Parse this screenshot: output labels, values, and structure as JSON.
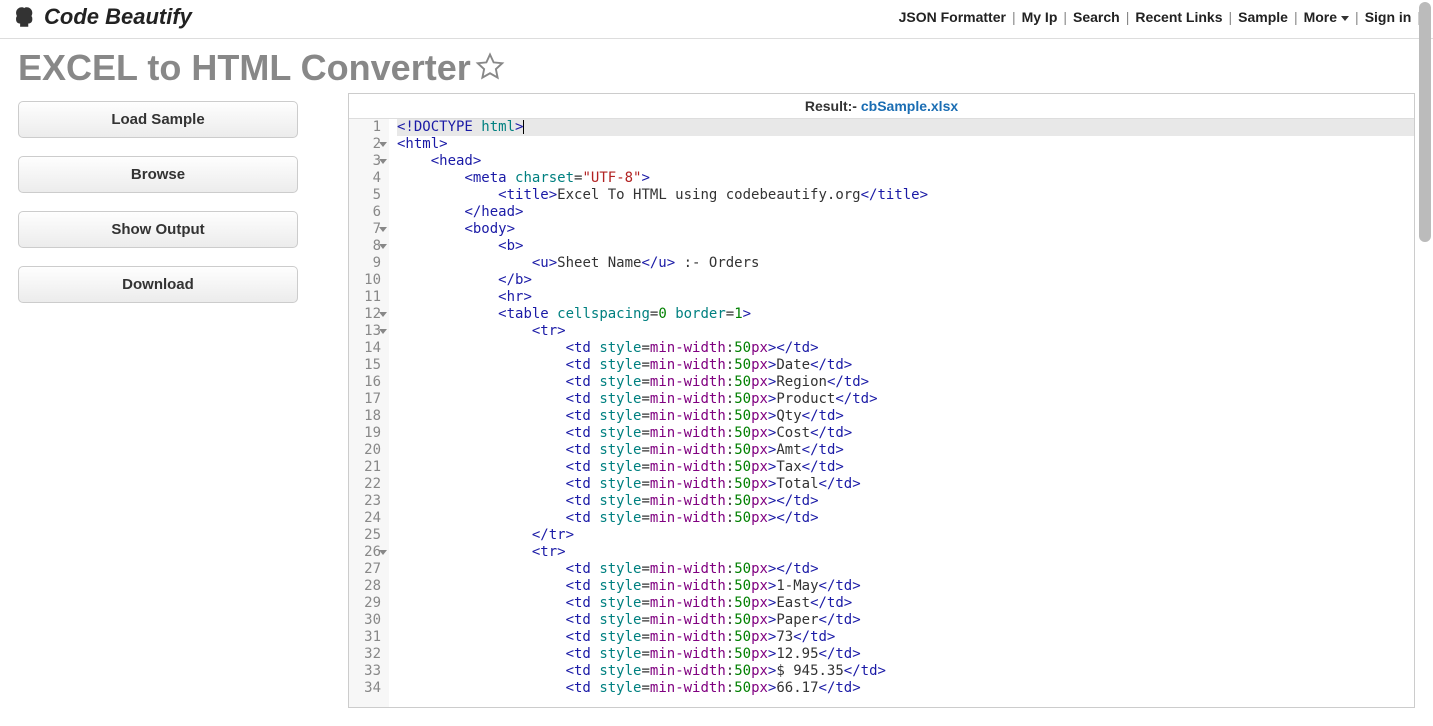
{
  "logo_text": "Code Beautify",
  "nav": {
    "json_formatter": "JSON Formatter",
    "my_ip": "My Ip",
    "search": "Search",
    "recent_links": "Recent Links",
    "sample": "Sample",
    "more": "More",
    "sign_in": "Sign in"
  },
  "page_title": "EXCEL to HTML Converter",
  "sidebar": {
    "load_sample": "Load Sample",
    "browse": "Browse",
    "show_output": "Show Output",
    "download": "Download"
  },
  "result": {
    "label": "Result:-",
    "file": "cbSample.xlsx"
  },
  "code": {
    "lines": [
      {
        "n": 1,
        "fold": false,
        "hl": true,
        "tokens": [
          [
            "tag",
            "<!DOCTYPE"
          ],
          [
            "txt",
            " "
          ],
          [
            "attr",
            "html"
          ],
          [
            "tag",
            ">"
          ]
        ],
        "cursor": true
      },
      {
        "n": 2,
        "fold": true,
        "hl": false,
        "indent": 0,
        "tokens": [
          [
            "tag",
            "<html>"
          ]
        ]
      },
      {
        "n": 3,
        "fold": true,
        "hl": false,
        "indent": 2,
        "tokens": [
          [
            "tag",
            "<head>"
          ]
        ]
      },
      {
        "n": 4,
        "fold": false,
        "hl": false,
        "indent": 4,
        "tokens": [
          [
            "tag",
            "<meta"
          ],
          [
            "txt",
            " "
          ],
          [
            "attr",
            "charset"
          ],
          [
            "txt",
            "="
          ],
          [
            "val",
            "\"UTF-8\""
          ],
          [
            "tag",
            ">"
          ]
        ]
      },
      {
        "n": 5,
        "fold": false,
        "hl": false,
        "indent": 6,
        "tokens": [
          [
            "tag",
            "<title>"
          ],
          [
            "txt",
            "Excel To HTML using codebeautify.org"
          ],
          [
            "tag",
            "</title>"
          ]
        ]
      },
      {
        "n": 6,
        "fold": false,
        "hl": false,
        "indent": 4,
        "tokens": [
          [
            "tag",
            "</head>"
          ]
        ]
      },
      {
        "n": 7,
        "fold": true,
        "hl": false,
        "indent": 4,
        "tokens": [
          [
            "tag",
            "<body>"
          ]
        ]
      },
      {
        "n": 8,
        "fold": true,
        "hl": false,
        "indent": 6,
        "tokens": [
          [
            "tag",
            "<b>"
          ]
        ]
      },
      {
        "n": 9,
        "fold": false,
        "hl": false,
        "indent": 8,
        "tokens": [
          [
            "tag",
            "<u>"
          ],
          [
            "txt",
            "Sheet Name"
          ],
          [
            "tag",
            "</u>"
          ],
          [
            "txt",
            " :- Orders"
          ]
        ]
      },
      {
        "n": 10,
        "fold": false,
        "hl": false,
        "indent": 6,
        "tokens": [
          [
            "tag",
            "</b>"
          ]
        ]
      },
      {
        "n": 11,
        "fold": false,
        "hl": false,
        "indent": 6,
        "tokens": [
          [
            "tag",
            "<hr>"
          ]
        ]
      },
      {
        "n": 12,
        "fold": true,
        "hl": false,
        "indent": 6,
        "tokens": [
          [
            "tag",
            "<table"
          ],
          [
            "txt",
            " "
          ],
          [
            "attr",
            "cellspacing"
          ],
          [
            "txt",
            "="
          ],
          [
            "num",
            "0"
          ],
          [
            "txt",
            " "
          ],
          [
            "attr",
            "border"
          ],
          [
            "txt",
            "="
          ],
          [
            "num",
            "1"
          ],
          [
            "tag",
            ">"
          ]
        ]
      },
      {
        "n": 13,
        "fold": true,
        "hl": false,
        "indent": 8,
        "tokens": [
          [
            "tag",
            "<tr>"
          ]
        ]
      },
      {
        "n": 14,
        "fold": false,
        "hl": false,
        "indent": 10,
        "tokens": [
          [
            "tag",
            "<td"
          ],
          [
            "txt",
            " "
          ],
          [
            "attr",
            "style"
          ],
          [
            "txt",
            "="
          ],
          [
            "kw",
            "min-width"
          ],
          [
            "txt",
            ":"
          ],
          [
            "num",
            "50"
          ],
          [
            "kw",
            "px"
          ],
          [
            "tag",
            ">"
          ],
          [
            "tag",
            "</td>"
          ]
        ]
      },
      {
        "n": 15,
        "fold": false,
        "hl": false,
        "indent": 10,
        "tokens": [
          [
            "tag",
            "<td"
          ],
          [
            "txt",
            " "
          ],
          [
            "attr",
            "style"
          ],
          [
            "txt",
            "="
          ],
          [
            "kw",
            "min-width"
          ],
          [
            "txt",
            ":"
          ],
          [
            "num",
            "50"
          ],
          [
            "kw",
            "px"
          ],
          [
            "tag",
            ">"
          ],
          [
            "txt",
            "Date"
          ],
          [
            "tag",
            "</td>"
          ]
        ]
      },
      {
        "n": 16,
        "fold": false,
        "hl": false,
        "indent": 10,
        "tokens": [
          [
            "tag",
            "<td"
          ],
          [
            "txt",
            " "
          ],
          [
            "attr",
            "style"
          ],
          [
            "txt",
            "="
          ],
          [
            "kw",
            "min-width"
          ],
          [
            "txt",
            ":"
          ],
          [
            "num",
            "50"
          ],
          [
            "kw",
            "px"
          ],
          [
            "tag",
            ">"
          ],
          [
            "txt",
            "Region"
          ],
          [
            "tag",
            "</td>"
          ]
        ]
      },
      {
        "n": 17,
        "fold": false,
        "hl": false,
        "indent": 10,
        "tokens": [
          [
            "tag",
            "<td"
          ],
          [
            "txt",
            " "
          ],
          [
            "attr",
            "style"
          ],
          [
            "txt",
            "="
          ],
          [
            "kw",
            "min-width"
          ],
          [
            "txt",
            ":"
          ],
          [
            "num",
            "50"
          ],
          [
            "kw",
            "px"
          ],
          [
            "tag",
            ">"
          ],
          [
            "txt",
            "Product"
          ],
          [
            "tag",
            "</td>"
          ]
        ]
      },
      {
        "n": 18,
        "fold": false,
        "hl": false,
        "indent": 10,
        "tokens": [
          [
            "tag",
            "<td"
          ],
          [
            "txt",
            " "
          ],
          [
            "attr",
            "style"
          ],
          [
            "txt",
            "="
          ],
          [
            "kw",
            "min-width"
          ],
          [
            "txt",
            ":"
          ],
          [
            "num",
            "50"
          ],
          [
            "kw",
            "px"
          ],
          [
            "tag",
            ">"
          ],
          [
            "txt",
            "Qty"
          ],
          [
            "tag",
            "</td>"
          ]
        ]
      },
      {
        "n": 19,
        "fold": false,
        "hl": false,
        "indent": 10,
        "tokens": [
          [
            "tag",
            "<td"
          ],
          [
            "txt",
            " "
          ],
          [
            "attr",
            "style"
          ],
          [
            "txt",
            "="
          ],
          [
            "kw",
            "min-width"
          ],
          [
            "txt",
            ":"
          ],
          [
            "num",
            "50"
          ],
          [
            "kw",
            "px"
          ],
          [
            "tag",
            ">"
          ],
          [
            "txt",
            "Cost"
          ],
          [
            "tag",
            "</td>"
          ]
        ]
      },
      {
        "n": 20,
        "fold": false,
        "hl": false,
        "indent": 10,
        "tokens": [
          [
            "tag",
            "<td"
          ],
          [
            "txt",
            " "
          ],
          [
            "attr",
            "style"
          ],
          [
            "txt",
            "="
          ],
          [
            "kw",
            "min-width"
          ],
          [
            "txt",
            ":"
          ],
          [
            "num",
            "50"
          ],
          [
            "kw",
            "px"
          ],
          [
            "tag",
            ">"
          ],
          [
            "txt",
            "Amt"
          ],
          [
            "tag",
            "</td>"
          ]
        ]
      },
      {
        "n": 21,
        "fold": false,
        "hl": false,
        "indent": 10,
        "tokens": [
          [
            "tag",
            "<td"
          ],
          [
            "txt",
            " "
          ],
          [
            "attr",
            "style"
          ],
          [
            "txt",
            "="
          ],
          [
            "kw",
            "min-width"
          ],
          [
            "txt",
            ":"
          ],
          [
            "num",
            "50"
          ],
          [
            "kw",
            "px"
          ],
          [
            "tag",
            ">"
          ],
          [
            "txt",
            "Tax"
          ],
          [
            "tag",
            "</td>"
          ]
        ]
      },
      {
        "n": 22,
        "fold": false,
        "hl": false,
        "indent": 10,
        "tokens": [
          [
            "tag",
            "<td"
          ],
          [
            "txt",
            " "
          ],
          [
            "attr",
            "style"
          ],
          [
            "txt",
            "="
          ],
          [
            "kw",
            "min-width"
          ],
          [
            "txt",
            ":"
          ],
          [
            "num",
            "50"
          ],
          [
            "kw",
            "px"
          ],
          [
            "tag",
            ">"
          ],
          [
            "txt",
            "Total"
          ],
          [
            "tag",
            "</td>"
          ]
        ]
      },
      {
        "n": 23,
        "fold": false,
        "hl": false,
        "indent": 10,
        "tokens": [
          [
            "tag",
            "<td"
          ],
          [
            "txt",
            " "
          ],
          [
            "attr",
            "style"
          ],
          [
            "txt",
            "="
          ],
          [
            "kw",
            "min-width"
          ],
          [
            "txt",
            ":"
          ],
          [
            "num",
            "50"
          ],
          [
            "kw",
            "px"
          ],
          [
            "tag",
            ">"
          ],
          [
            "tag",
            "</td>"
          ]
        ]
      },
      {
        "n": 24,
        "fold": false,
        "hl": false,
        "indent": 10,
        "tokens": [
          [
            "tag",
            "<td"
          ],
          [
            "txt",
            " "
          ],
          [
            "attr",
            "style"
          ],
          [
            "txt",
            "="
          ],
          [
            "kw",
            "min-width"
          ],
          [
            "txt",
            ":"
          ],
          [
            "num",
            "50"
          ],
          [
            "kw",
            "px"
          ],
          [
            "tag",
            ">"
          ],
          [
            "tag",
            "</td>"
          ]
        ]
      },
      {
        "n": 25,
        "fold": false,
        "hl": false,
        "indent": 8,
        "tokens": [
          [
            "tag",
            "</tr>"
          ]
        ]
      },
      {
        "n": 26,
        "fold": true,
        "hl": false,
        "indent": 8,
        "tokens": [
          [
            "tag",
            "<tr>"
          ]
        ]
      },
      {
        "n": 27,
        "fold": false,
        "hl": false,
        "indent": 10,
        "tokens": [
          [
            "tag",
            "<td"
          ],
          [
            "txt",
            " "
          ],
          [
            "attr",
            "style"
          ],
          [
            "txt",
            "="
          ],
          [
            "kw",
            "min-width"
          ],
          [
            "txt",
            ":"
          ],
          [
            "num",
            "50"
          ],
          [
            "kw",
            "px"
          ],
          [
            "tag",
            ">"
          ],
          [
            "tag",
            "</td>"
          ]
        ]
      },
      {
        "n": 28,
        "fold": false,
        "hl": false,
        "indent": 10,
        "tokens": [
          [
            "tag",
            "<td"
          ],
          [
            "txt",
            " "
          ],
          [
            "attr",
            "style"
          ],
          [
            "txt",
            "="
          ],
          [
            "kw",
            "min-width"
          ],
          [
            "txt",
            ":"
          ],
          [
            "num",
            "50"
          ],
          [
            "kw",
            "px"
          ],
          [
            "tag",
            ">"
          ],
          [
            "txt",
            "1-May"
          ],
          [
            "tag",
            "</td>"
          ]
        ]
      },
      {
        "n": 29,
        "fold": false,
        "hl": false,
        "indent": 10,
        "tokens": [
          [
            "tag",
            "<td"
          ],
          [
            "txt",
            " "
          ],
          [
            "attr",
            "style"
          ],
          [
            "txt",
            "="
          ],
          [
            "kw",
            "min-width"
          ],
          [
            "txt",
            ":"
          ],
          [
            "num",
            "50"
          ],
          [
            "kw",
            "px"
          ],
          [
            "tag",
            ">"
          ],
          [
            "txt",
            "East"
          ],
          [
            "tag",
            "</td>"
          ]
        ]
      },
      {
        "n": 30,
        "fold": false,
        "hl": false,
        "indent": 10,
        "tokens": [
          [
            "tag",
            "<td"
          ],
          [
            "txt",
            " "
          ],
          [
            "attr",
            "style"
          ],
          [
            "txt",
            "="
          ],
          [
            "kw",
            "min-width"
          ],
          [
            "txt",
            ":"
          ],
          [
            "num",
            "50"
          ],
          [
            "kw",
            "px"
          ],
          [
            "tag",
            ">"
          ],
          [
            "txt",
            "Paper"
          ],
          [
            "tag",
            "</td>"
          ]
        ]
      },
      {
        "n": 31,
        "fold": false,
        "hl": false,
        "indent": 10,
        "tokens": [
          [
            "tag",
            "<td"
          ],
          [
            "txt",
            " "
          ],
          [
            "attr",
            "style"
          ],
          [
            "txt",
            "="
          ],
          [
            "kw",
            "min-width"
          ],
          [
            "txt",
            ":"
          ],
          [
            "num",
            "50"
          ],
          [
            "kw",
            "px"
          ],
          [
            "tag",
            ">"
          ],
          [
            "txt",
            "73"
          ],
          [
            "tag",
            "</td>"
          ]
        ]
      },
      {
        "n": 32,
        "fold": false,
        "hl": false,
        "indent": 10,
        "tokens": [
          [
            "tag",
            "<td"
          ],
          [
            "txt",
            " "
          ],
          [
            "attr",
            "style"
          ],
          [
            "txt",
            "="
          ],
          [
            "kw",
            "min-width"
          ],
          [
            "txt",
            ":"
          ],
          [
            "num",
            "50"
          ],
          [
            "kw",
            "px"
          ],
          [
            "tag",
            ">"
          ],
          [
            "txt",
            "12.95"
          ],
          [
            "tag",
            "</td>"
          ]
        ]
      },
      {
        "n": 33,
        "fold": false,
        "hl": false,
        "indent": 10,
        "tokens": [
          [
            "tag",
            "<td"
          ],
          [
            "txt",
            " "
          ],
          [
            "attr",
            "style"
          ],
          [
            "txt",
            "="
          ],
          [
            "kw",
            "min-width"
          ],
          [
            "txt",
            ":"
          ],
          [
            "num",
            "50"
          ],
          [
            "kw",
            "px"
          ],
          [
            "tag",
            ">"
          ],
          [
            "txt",
            "$ 945.35"
          ],
          [
            "tag",
            "</td>"
          ]
        ]
      },
      {
        "n": 34,
        "fold": false,
        "hl": false,
        "indent": 10,
        "tokens": [
          [
            "tag",
            "<td"
          ],
          [
            "txt",
            " "
          ],
          [
            "attr",
            "style"
          ],
          [
            "txt",
            "="
          ],
          [
            "kw",
            "min-width"
          ],
          [
            "txt",
            ":"
          ],
          [
            "num",
            "50"
          ],
          [
            "kw",
            "px"
          ],
          [
            "tag",
            ">"
          ],
          [
            "txt",
            "66.17"
          ],
          [
            "tag",
            "</td>"
          ]
        ]
      }
    ]
  }
}
